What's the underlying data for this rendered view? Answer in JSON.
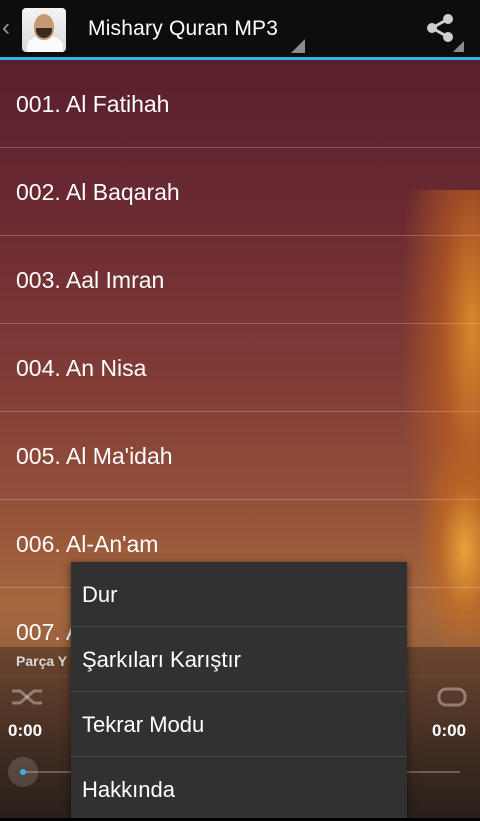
{
  "action_bar": {
    "up_glyph": "‹",
    "title": "Mishary Quran MP3",
    "share_icon": "share-icon",
    "accent_color": "#33b5e5"
  },
  "surahs": [
    {
      "label": "001. Al Fatihah"
    },
    {
      "label": "002. Al Baqarah"
    },
    {
      "label": "003. Aal Imran"
    },
    {
      "label": "004. An Nisa"
    },
    {
      "label": "005. Al Ma'idah"
    },
    {
      "label": "006. Al-An'am"
    },
    {
      "label": "007. A"
    }
  ],
  "player": {
    "track_label": "Parça Y",
    "elapsed": "0:00",
    "duration": "0:00",
    "progress": 0
  },
  "menu": {
    "items": [
      {
        "label": "Dur"
      },
      {
        "label": "Şarkıları Karıştır"
      },
      {
        "label": "Tekrar Modu"
      },
      {
        "label": "Hakkında"
      }
    ]
  }
}
